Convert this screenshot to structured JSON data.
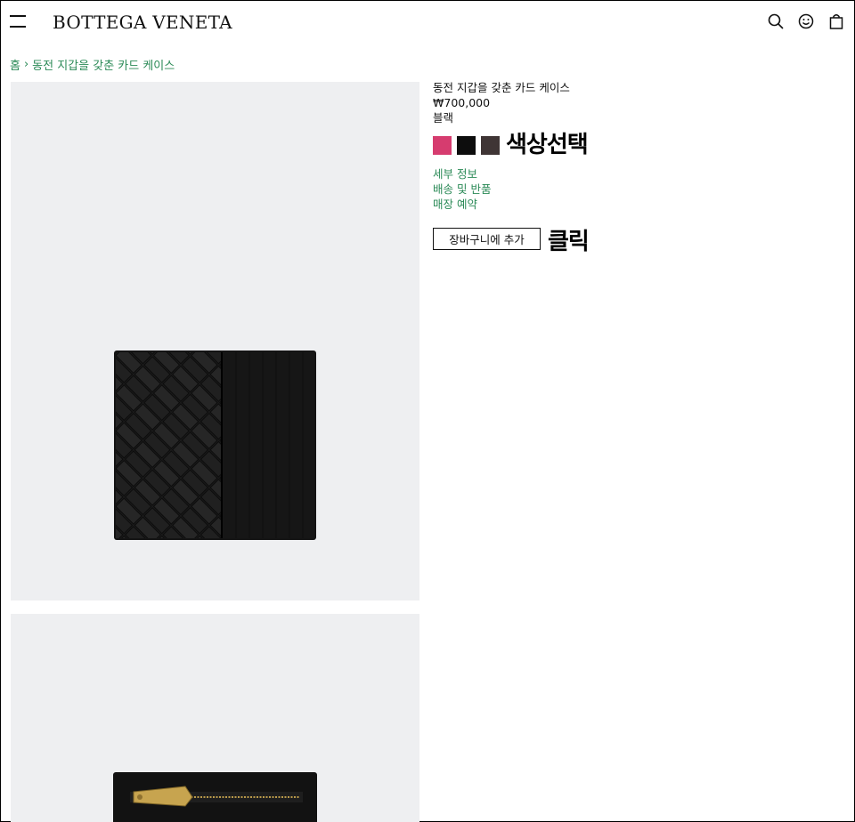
{
  "header": {
    "logo": "BOTTEGA VENETA",
    "menu_icon": "hamburger-icon",
    "icons": [
      "search-icon",
      "account-smiley-icon",
      "shopping-bag-icon"
    ]
  },
  "breadcrumb": {
    "home": "홈",
    "separator": "›",
    "current": "동전 지갑을 갖춘 카드 케이스"
  },
  "product": {
    "title": "동전 지갑을 갖춘 카드 케이스",
    "price": "₩700,000",
    "selected_color": "블랙",
    "swatches": [
      {
        "name": "pink",
        "color": "#d63c6f"
      },
      {
        "name": "black",
        "color": "#0d0d0d"
      },
      {
        "name": "dark-brown",
        "color": "#3f3535"
      }
    ],
    "links": [
      "세부 정보",
      "배송 및 반품",
      "매장 예약"
    ],
    "add_to_cart": "장바구니에 추가"
  },
  "annotations": {
    "color_select": "색상선택",
    "click": "클릭"
  },
  "colors": {
    "link_green": "#2b8a57",
    "image_bg": "#eeeff1"
  }
}
